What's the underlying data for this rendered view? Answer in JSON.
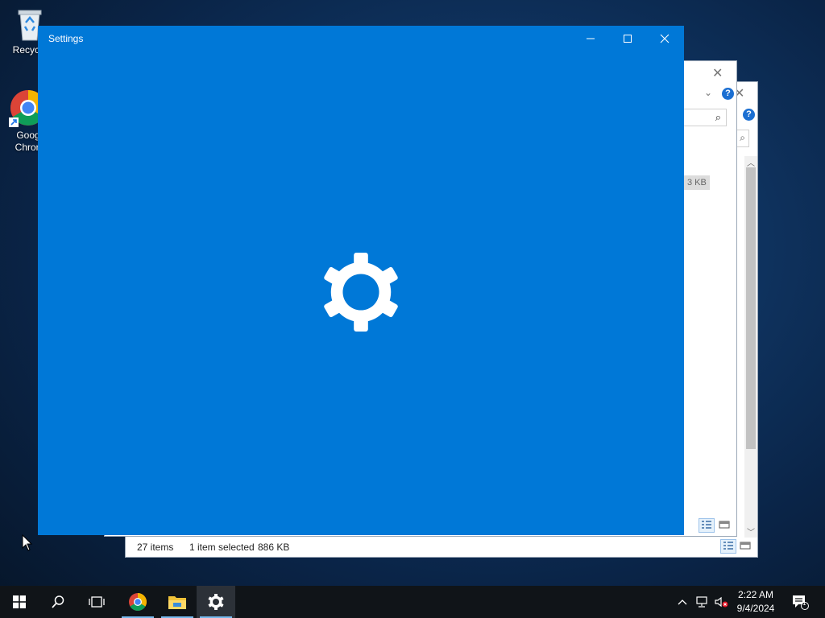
{
  "desktop": {
    "icons": [
      {
        "label": "Recycle"
      },
      {
        "label_line1": "Goog",
        "label_line2": "Chron"
      }
    ]
  },
  "explorer": {
    "size_chip": "3 KB",
    "status": {
      "items": "27 items",
      "selected": "1 item selected",
      "size": "886 KB"
    }
  },
  "settings": {
    "title": "Settings",
    "accent": "#0078d7"
  },
  "taskbar": {
    "clock": {
      "time": "2:22 AM",
      "date": "9/4/2024"
    },
    "notifications_count": "1",
    "buttons": [
      "start-icon",
      "search-icon",
      "task-view-icon",
      "chrome-icon",
      "file-explorer-icon",
      "settings-gear-icon"
    ]
  }
}
